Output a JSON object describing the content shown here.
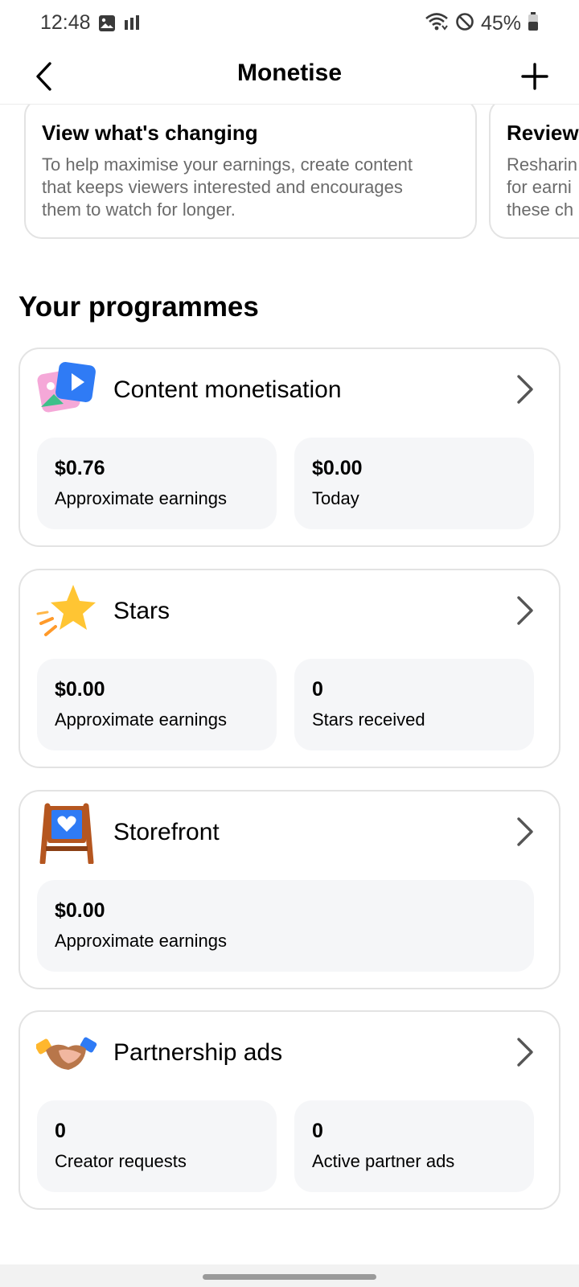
{
  "status_bar": {
    "time": "12:48",
    "battery_percent": "45%",
    "icons": [
      "image-icon",
      "signal-bars-icon",
      "wifi-icon",
      "do-not-disturb-icon",
      "battery-icon"
    ]
  },
  "header": {
    "title": "Monetise",
    "back_icon": "chevron-left-icon",
    "add_icon": "plus-icon"
  },
  "info_cards": [
    {
      "title": "View what's changing",
      "lines": [
        "To help maximise your earnings, create content",
        "that keeps viewers interested and encourages",
        "them to watch for longer."
      ]
    },
    {
      "title": "Review",
      "lines": [
        "Resharin",
        "for earni",
        "these ch"
      ]
    }
  ],
  "section_title": "Your programmes",
  "programmes": [
    {
      "title": "Content monetisation",
      "icon": "content-monetisation-icon",
      "stats": [
        {
          "value": "$0.76",
          "label": "Approximate earnings"
        },
        {
          "value": "$0.00",
          "label": "Today"
        }
      ]
    },
    {
      "title": "Stars",
      "icon": "star-icon",
      "stats": [
        {
          "value": "$0.00",
          "label": "Approximate earnings"
        },
        {
          "value": "0",
          "label": "Stars received"
        }
      ]
    },
    {
      "title": "Storefront",
      "icon": "storefront-sign-icon",
      "stats": [
        {
          "value": "$0.00",
          "label": "Approximate earnings"
        }
      ]
    },
    {
      "title": "Partnership ads",
      "icon": "handshake-icon",
      "stats": [
        {
          "value": "0",
          "label": "Creator requests"
        },
        {
          "value": "0",
          "label": "Active partner ads"
        }
      ]
    }
  ],
  "colors": {
    "card_border": "#e3e3e3",
    "stat_box_bg": "#f5f6f8",
    "muted_text": "#6b6b6b",
    "icon_blue": "#2f7bf5",
    "star_yellow": "#ffc533",
    "wood_brown": "#b5561f"
  }
}
